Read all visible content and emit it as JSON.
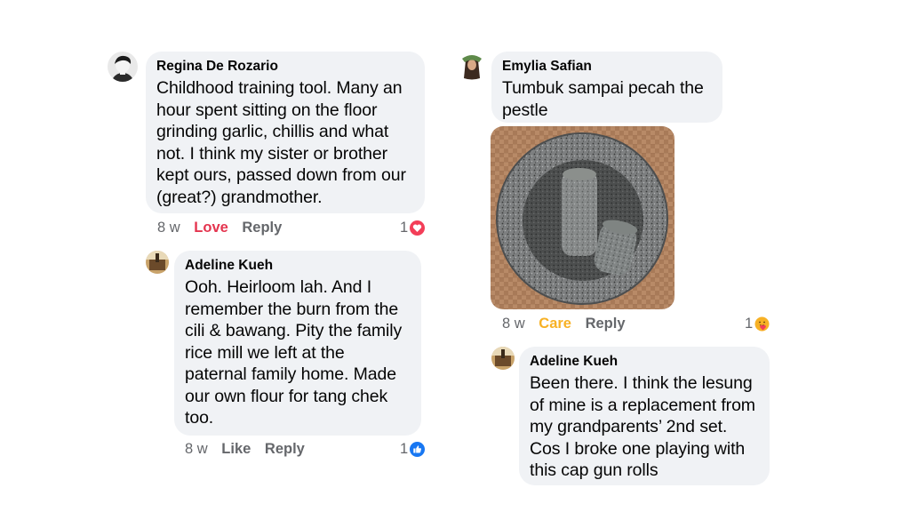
{
  "colors": {
    "bubble_bg": "#f0f2f5",
    "meta_text": "#65676b",
    "love": "#e4354f",
    "care": "#f7b125",
    "like": "#1877f2"
  },
  "comments": [
    {
      "author": "Regina De Rozario",
      "text": "Childhood training tool. Many an hour spent sitting on the floor grinding garlic, chillis and what not. I think my sister or brother kept ours, passed down from our (great?) grandmother.",
      "time": "8 w",
      "reaction_label": "Love",
      "reply_label": "Reply",
      "reaction_count": "1",
      "reaction_icon": "love-reaction-icon"
    },
    {
      "author": "Adeline Kueh",
      "text": "Ooh. Heirloom lah. And I remember the burn from the cili & bawang. Pity the family rice mill we left at the paternal family home. Made our own flour for tang chek too.",
      "time": "8 w",
      "reaction_label": "Like",
      "reply_label": "Reply",
      "reaction_count": "1",
      "reaction_icon": "like-reaction-icon"
    },
    {
      "author": "Emylia Safian",
      "text": "Tumbuk sampai pecah the pestle",
      "time": "8 w",
      "reaction_label": "Care",
      "reply_label": "Reply",
      "reaction_count": "1",
      "reaction_icon": "care-reaction-icon",
      "attachment": "mortar-and-pestle-photo"
    },
    {
      "author": "Adeline Kueh",
      "text": "Been there. I think the lesung of mine is a replacement from my grandparents’ 2nd set. Cos I broke one playing with this cap gun rolls"
    }
  ]
}
